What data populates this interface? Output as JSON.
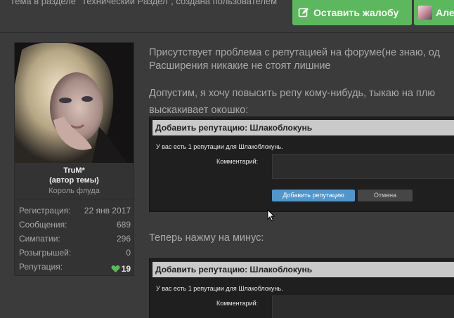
{
  "top": {
    "breadcrumb_text": "Тема в разделе \"Технический Раздел\", создана пользователем",
    "complain_label": "Оставить жалобу",
    "user_chip_label": "Але"
  },
  "usercard": {
    "name": "TruM*",
    "author_tag": "(автор темы)",
    "role": "Король флуда",
    "stats": [
      {
        "label": "Регистрация:",
        "value": "22 янв 2017"
      },
      {
        "label": "Сообщения:",
        "value": "689"
      },
      {
        "label": "Симпатии:",
        "value": "296"
      },
      {
        "label": "Розыгрышей:",
        "value": "0"
      },
      {
        "label": "Репутация:",
        "value": "19"
      }
    ]
  },
  "post": {
    "line1": "Присутствует проблема с репутацией на форуме(не знаю, од",
    "line2": "Расширения никакие не стоят лишние",
    "line3": "Допустим, я хочу повысить репу кому-нибудь, тыкаю на плю",
    "line4": "выскакивает окошко:",
    "line5": "Теперь нажму на минус:"
  },
  "dialog1": {
    "title": "Добавить репутацию: Шлакоблокунь",
    "info": "У вас есть 1 репутации для Шлакоблокунь.",
    "comment_label": "Комментарий:",
    "add_button": "Добавить репутацию",
    "cancel_button": "Отмена"
  },
  "dialog2": {
    "title": "Добавить репутацию: Шлакоблокунь",
    "info": "У вас есть 1 репутации для Шлакоблокунь.",
    "comment_label": "Комментарий:"
  },
  "colors": {
    "accent_green": "#5cb85c",
    "reputation_heart": "#5cb85c",
    "button_blue": "#4f97cc"
  }
}
